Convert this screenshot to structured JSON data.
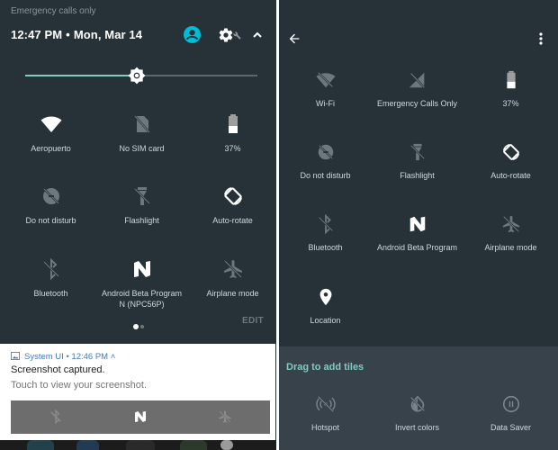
{
  "left_panel": {
    "carrier_text": "Emergency calls only",
    "time": "12:47 PM",
    "separator": "•",
    "date": "Mon, Mar 14",
    "brightness_level": 0.48,
    "accent_color": "#80cbc4",
    "user_avatar_color": "#00bcd4",
    "tiles": [
      {
        "label": "Aeropuerto",
        "icon": "wifi-icon",
        "active": true
      },
      {
        "label": "No SIM card",
        "icon": "no-sim-icon",
        "active": false
      },
      {
        "label": "37%",
        "icon": "battery-icon",
        "active": true
      },
      {
        "label": "Do not disturb",
        "icon": "do-not-disturb-off-icon",
        "active": false
      },
      {
        "label": "Flashlight",
        "icon": "flashlight-off-icon",
        "active": false
      },
      {
        "label": "Auto-rotate",
        "icon": "auto-rotate-icon",
        "active": true
      },
      {
        "label": "Bluetooth",
        "icon": "bluetooth-off-icon",
        "active": false
      },
      {
        "label": "Android Beta Program\nN (NPC56P)",
        "icon": "android-n-icon",
        "active": true
      },
      {
        "label": "Airplane mode",
        "icon": "airplane-off-icon",
        "active": false
      }
    ],
    "page_indicator": {
      "current": 1,
      "total": 2
    },
    "edit_label": "EDIT",
    "notification": {
      "app": "System UI",
      "time": "12:46 PM",
      "title": "Screenshot captured.",
      "body": "Touch to view your screenshot."
    }
  },
  "right_panel": {
    "tiles": [
      {
        "label": "Wi-Fi",
        "icon": "wifi-off-icon",
        "active": false
      },
      {
        "label": "Emergency Calls Only",
        "icon": "no-signal-icon",
        "active": false
      },
      {
        "label": "37%",
        "icon": "battery-icon",
        "active": true
      },
      {
        "label": "Do not disturb",
        "icon": "do-not-disturb-off-icon",
        "active": false
      },
      {
        "label": "Flashlight",
        "icon": "flashlight-off-icon",
        "active": false
      },
      {
        "label": "Auto-rotate",
        "icon": "auto-rotate-icon",
        "active": true
      },
      {
        "label": "Bluetooth",
        "icon": "bluetooth-off-icon",
        "active": false
      },
      {
        "label": "Android Beta Program",
        "icon": "android-n-icon",
        "active": true
      },
      {
        "label": "Airplane mode",
        "icon": "airplane-off-icon",
        "active": false
      },
      {
        "label": "Location",
        "icon": "location-icon",
        "active": true
      }
    ],
    "add_section_title": "Drag to add tiles",
    "available_tiles": [
      {
        "label": "Hotspot",
        "icon": "hotspot-off-icon"
      },
      {
        "label": "Invert colors",
        "icon": "invert-colors-off-icon"
      },
      {
        "label": "Data Saver",
        "icon": "data-saver-icon"
      }
    ]
  }
}
